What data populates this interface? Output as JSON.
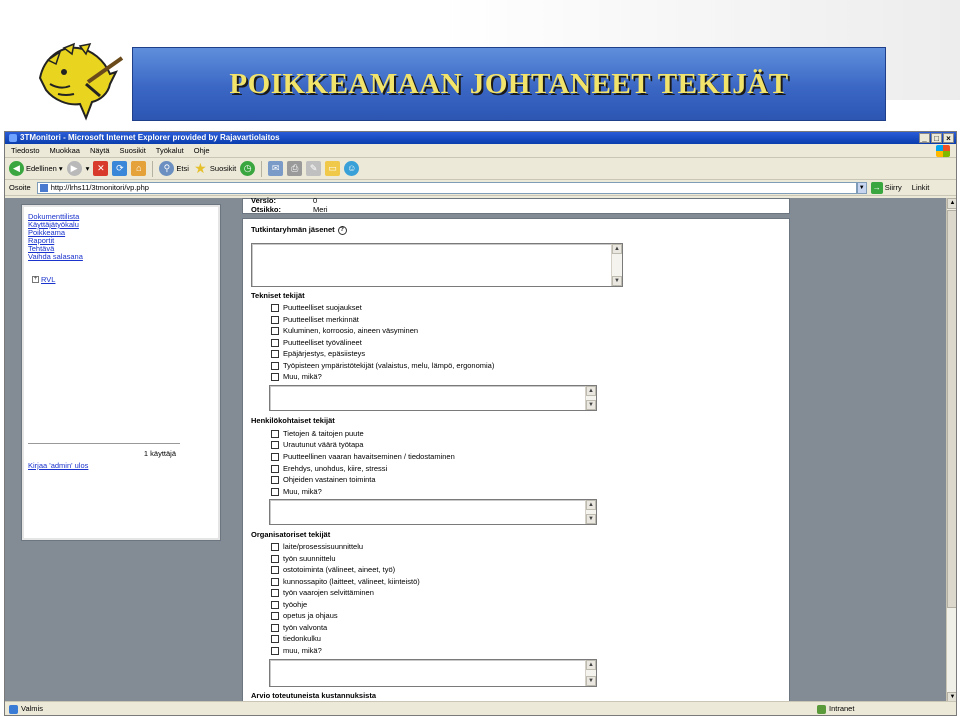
{
  "slide": {
    "title": "POIKKEAMAAN JOHTANEET TEKIJÄT",
    "colors": {
      "band": "#3b67c4",
      "title_text": "#f2e36a",
      "emblem": "#e7d21f"
    }
  },
  "browser": {
    "window_title": "3TMonitori - Microsoft Internet Explorer provided by Rajavartiolaitos",
    "window_buttons": [
      "_",
      "□",
      "×"
    ],
    "menu": [
      "Tiedosto",
      "Muokkaa",
      "Näytä",
      "Suosikit",
      "Työkalut",
      "Ohje"
    ],
    "toolbar": {
      "back_label": "Edellinen",
      "search_label": "Etsi",
      "favorites_label": "Suosikit"
    },
    "address": {
      "label": "Osoite",
      "url": "http://lrhs11/3tmonitori/vp.php",
      "go_label": "Siirry",
      "links_label": "Linkit"
    },
    "status": {
      "left": "Valmis",
      "zone": "Intranet"
    }
  },
  "left_panel": {
    "links": [
      "Dokumenttilista",
      "Käyttäjätyökalu",
      "Poikkeama",
      "Raportit",
      "Tehtävä",
      "Vaihda salasana"
    ],
    "tree_item": "RVL",
    "user_count": "1 käyttäjä",
    "logout": "Kirjaa 'admin' ulos"
  },
  "main": {
    "top_info": [
      {
        "label": "Versio:",
        "value": "0"
      },
      {
        "label": "Otsikko:",
        "value": "Meri"
      }
    ],
    "team_label": "Tutkintaryhmän jäsenet",
    "technical": {
      "heading": "Tekniset tekijät",
      "items": [
        "Puutteelliset suojaukset",
        "Puutteelliset merkinnät",
        "Kuluminen, korroosio, aineen väsyminen",
        "Puutteelliset työvälineet",
        "Epäjärjestys, epäsiisteys",
        "Työpisteen ympäristötekijät (valaistus, melu, lämpö, ergonomia)",
        "Muu, mikä?"
      ]
    },
    "personal": {
      "heading": "Henkilökohtaiset tekijät",
      "items": [
        "Tietojen & taitojen puute",
        "Urautunut väärä työtapa",
        "Puutteellinen vaaran havaitseminen / tiedostaminen",
        "Erehdys, unohdus, kiire, stressi",
        "Ohjeiden vastainen toiminta",
        "Muu, mikä?"
      ]
    },
    "organizational": {
      "heading": "Organisatoriset tekijät",
      "items": [
        "laite/prosessisuunnittelu",
        "työn suunnittelu",
        "ostotoiminta (välineet, aineet, työ)",
        "kunnossapito (laitteet, välineet, kiinteistö)",
        "työn vaarojen selvittäminen",
        "työohje",
        "opetus ja ohjaus",
        "työn valvonta",
        "tiedonkulku",
        "muu, mikä?"
      ]
    },
    "cost_label": "Arvio toteutuneista kustannuksista"
  }
}
